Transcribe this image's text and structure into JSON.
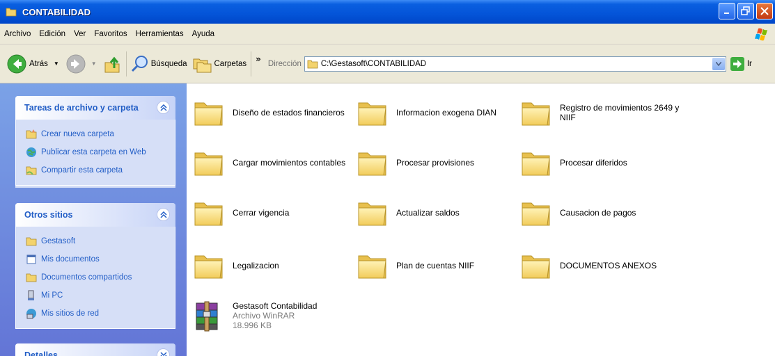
{
  "window": {
    "title": "CONTABILIDAD"
  },
  "menu": [
    "Archivo",
    "Edición",
    "Ver",
    "Favoritos",
    "Herramientas",
    "Ayuda"
  ],
  "toolbar": {
    "back_label": "Atrás",
    "search_label": "Búsqueda",
    "folders_label": "Carpetas",
    "more": "»",
    "address_label": "Dirección",
    "address_value": "C:\\Gestasoft\\CONTABILIDAD",
    "go_label": "Ir"
  },
  "tasks_panel": {
    "title": "Tareas de archivo y carpeta",
    "items": [
      {
        "label": "Crear nueva carpeta",
        "icon": "new-folder-icon"
      },
      {
        "label": "Publicar esta carpeta en Web",
        "icon": "web-publish-icon"
      },
      {
        "label": "Compartir esta carpeta",
        "icon": "share-folder-icon"
      }
    ]
  },
  "other_places": {
    "title": "Otros sitios",
    "items": [
      {
        "label": "Gestasoft",
        "icon": "folder-icon"
      },
      {
        "label": "Mis documentos",
        "icon": "my-documents-icon"
      },
      {
        "label": "Documentos compartidos",
        "icon": "shared-documents-icon"
      },
      {
        "label": "Mi PC",
        "icon": "my-computer-icon"
      },
      {
        "label": "Mis sitios de red",
        "icon": "network-places-icon"
      }
    ]
  },
  "details_panel": {
    "title": "Detalles"
  },
  "files": [
    {
      "name": "Diseño de estados financieros",
      "type": "folder"
    },
    {
      "name": "Informacion exogena DIAN",
      "type": "folder"
    },
    {
      "name": "Registro de movimientos 2649 y NIIF",
      "type": "folder"
    },
    {
      "name": "Cargar movimientos contables",
      "type": "folder"
    },
    {
      "name": "Procesar provisiones",
      "type": "folder"
    },
    {
      "name": "Procesar diferidos",
      "type": "folder"
    },
    {
      "name": "Cerrar vigencia",
      "type": "folder"
    },
    {
      "name": "Actualizar saldos",
      "type": "folder"
    },
    {
      "name": "Causacion de pagos",
      "type": "folder"
    },
    {
      "name": "Legalizacion",
      "type": "folder"
    },
    {
      "name": "Plan de cuentas NIIF",
      "type": "folder"
    },
    {
      "name": "DOCUMENTOS ANEXOS",
      "type": "folder"
    },
    {
      "name": "Gestasoft Contabilidad",
      "type": "archive",
      "filetype": "Archivo WinRAR",
      "size": "18.996 KB"
    }
  ],
  "colors": {
    "title_bar": "#0454d8",
    "link": "#215dc6",
    "pane": "#7ba2e7",
    "folder": "#f6d571"
  }
}
